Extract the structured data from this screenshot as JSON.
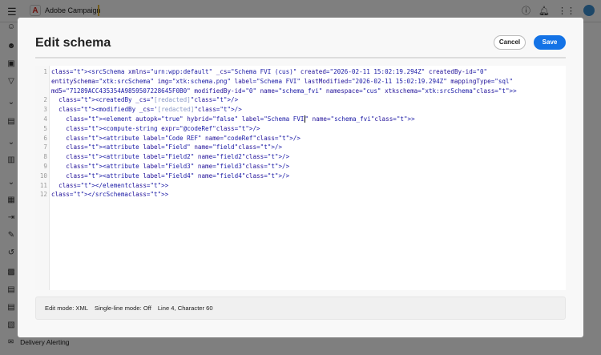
{
  "header": {
    "app_name": "Adobe Campaign",
    "icons": [
      "menu-icon",
      "help-icon",
      "bell-icon",
      "apps-icon",
      "avatar"
    ]
  },
  "sidebar": {
    "bottom_item": "Delivery Alerting"
  },
  "modal": {
    "title": "Edit schema",
    "cancel_label": "Cancel",
    "save_label": "Save"
  },
  "editor": {
    "line_numbers": [
      "1",
      "2",
      "3",
      "4",
      "5",
      "6",
      "7",
      "8",
      "9",
      "10",
      "11",
      "12"
    ],
    "lines": [
      "<srcSchema xmlns=\"urn:wpp:default\" _cs=\"Schema FVI (cus)\" created=\"2026-02-11 15:02:19.294Z\" createdBy-id=\"0\" entitySchema=\"xtk:srcSchema\" img=\"xtk:schema.png\" label=\"Schema FVI\" lastModified=\"2026-02-11 15:02:19.294Z\" mappingType=\"sql\" md5=\"71289ACC435354A9859507228645F0B0\" modifiedBy-id=\"0\" name=\"schema_fvi\" namespace=\"cus\" xtkschema=\"xtk:srcSchema\">",
      "  <createdBy _cs=\"[redacted]\"/>",
      "  <modifiedBy _cs='[redacted]\"/>",
      "    <element autopk=\"true\" hybrid=\"false\" label=\"Schema FVI\" name=\"schema_fvi\">",
      "    <compute-string expr=\"@codeRef\"/>",
      "    <attribute label=\"Code REF\" name=\"codeRef\"/>",
      "    <attribute label=\"Field\" name=\"field\"/>",
      "    <attribute label=\"Field2\" name=\"field2\"/>",
      "    <attribute label=\"Field3\" name=\"field3\"/>",
      "    <attribute label=\"Field4\" name=\"field4\"/>",
      "  </element>",
      "</srcSchema>"
    ]
  },
  "status": {
    "edit_mode": "Edit mode: XML",
    "single_line": "Single-line mode: Off",
    "position": "Line 4, Character 60"
  }
}
